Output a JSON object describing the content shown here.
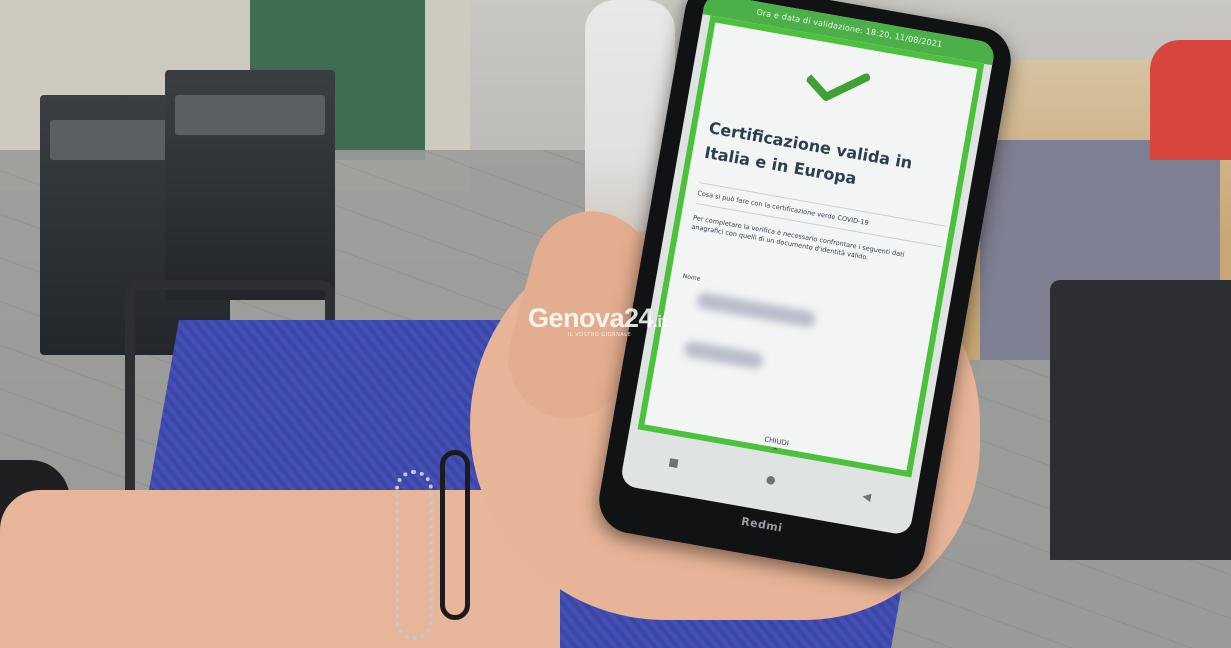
{
  "scene": {
    "description_colors": {
      "validation_green": "#4cc13c",
      "status_green": "#4bb048",
      "text_dark": "#2c3e50"
    }
  },
  "app": {
    "status_bar": "Ora e data di validazione: 18:20, 11/08/2021",
    "check_icon": "check-icon",
    "title": "Certificazione valida in Italia e in Europa",
    "subtitle": "Cosa si può fare con la certificazione verde COVID-19",
    "instructions": "Per completare la verifica è necessario confrontare i seguenti dati anagrafici con quelli di un documento d'identità valido.",
    "field_label": "Nome",
    "close_label": "CHIUDI",
    "close_chevron": "⌃",
    "nav": {
      "recent": "■",
      "home": "●",
      "back": "◀"
    }
  },
  "device": {
    "brand": "Redmi"
  },
  "watermark": {
    "main": "Genova24",
    "tld": ".it",
    "tagline": "IL VOSTRO GIORNALE"
  }
}
